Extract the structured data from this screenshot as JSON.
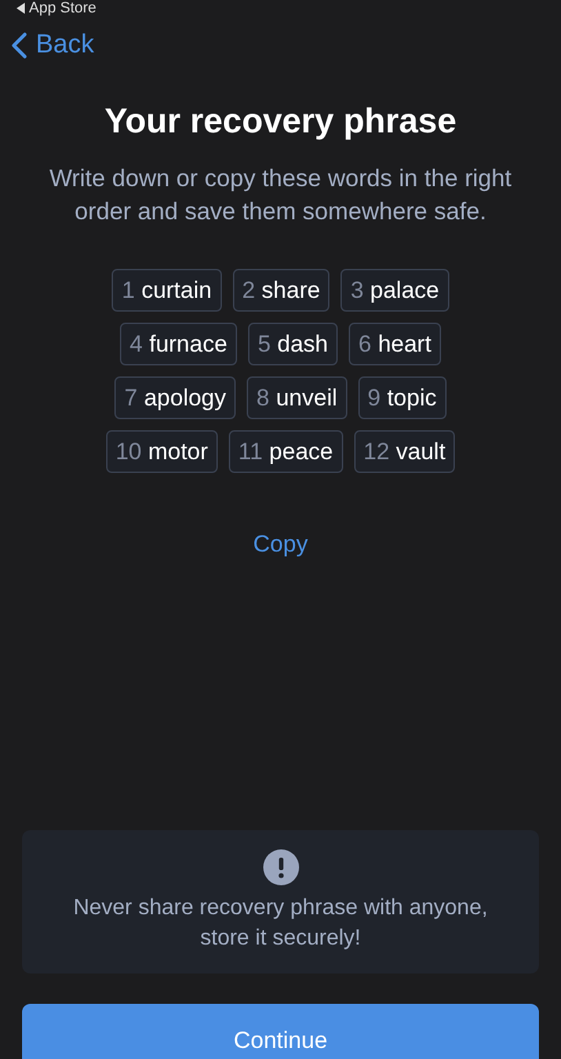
{
  "status_bar": {
    "back_app": "App Store"
  },
  "nav": {
    "back": "Back"
  },
  "title": "Your recovery phrase",
  "subtitle": "Write down or copy these words in the right order and save them somewhere safe.",
  "words": [
    {
      "number": "1",
      "word": "curtain"
    },
    {
      "number": "2",
      "word": "share"
    },
    {
      "number": "3",
      "word": "palace"
    },
    {
      "number": "4",
      "word": "furnace"
    },
    {
      "number": "5",
      "word": "dash"
    },
    {
      "number": "6",
      "word": "heart"
    },
    {
      "number": "7",
      "word": "apology"
    },
    {
      "number": "8",
      "word": "unveil"
    },
    {
      "number": "9",
      "word": "topic"
    },
    {
      "number": "10",
      "word": "motor"
    },
    {
      "number": "11",
      "word": "peace"
    },
    {
      "number": "12",
      "word": "vault"
    }
  ],
  "copy": "Copy",
  "warning": {
    "text": "Never share recovery phrase with anyone, store it securely!"
  },
  "button": "Continue"
}
